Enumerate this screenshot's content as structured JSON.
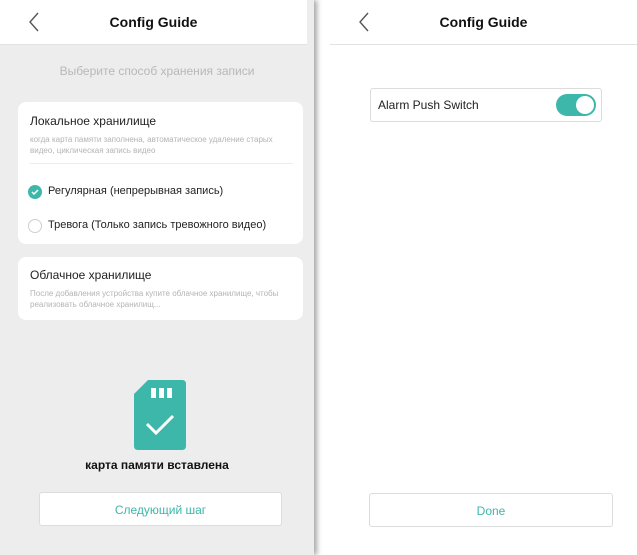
{
  "left_screen": {
    "title": "Config Guide",
    "subtitle": "Выберите способ хранения записи",
    "local_storage": {
      "title": "Локальное хранилище",
      "description": "когда карта памяти заполнена, автоматическое удаление старых видео, циклическая запись видео",
      "options": [
        {
          "label": "Регулярная (непрерывная запись)",
          "selected": true
        },
        {
          "label": "Тревога (Только запись тревожного видео)",
          "selected": false
        }
      ]
    },
    "cloud_storage": {
      "title": "Облачное хранилище",
      "description": "После добавления устройства купите облачное хранилище, чтобы реализовать облачное хранилищ..."
    },
    "sd_card_status": "карта памяти вставлена",
    "next_button": "Следующий шаг"
  },
  "right_screen": {
    "title": "Config Guide",
    "alarm_push": {
      "label": "Alarm Push Switch",
      "enabled": true
    },
    "done_button": "Done"
  },
  "colors": {
    "accent": "#3cb7aa",
    "page_background": "#ededed",
    "card_background": "#ffffff",
    "hint_text": "#b4b4b4"
  },
  "icons": {
    "back": "chevron-left-icon",
    "sd_card": "sd-card-check-icon",
    "radio_checked": "checkmark-icon"
  }
}
